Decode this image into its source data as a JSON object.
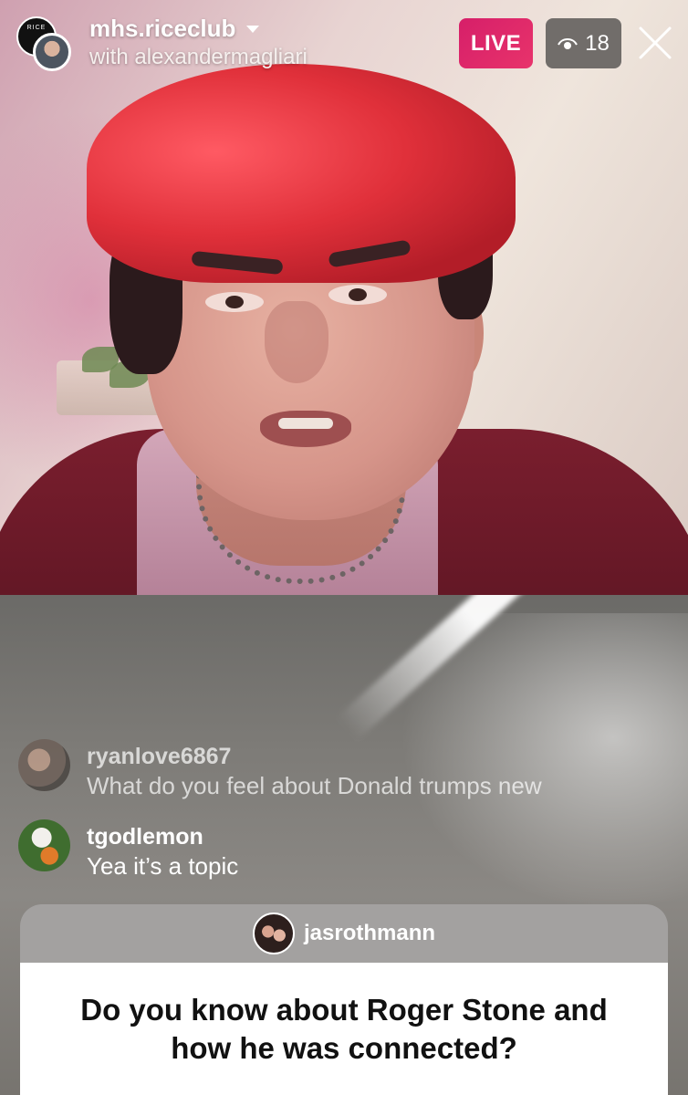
{
  "header": {
    "host_avatar_text": "RICE",
    "host_name": "mhs.riceclub",
    "with_line": "with alexandermagliari",
    "live_label": "LIVE",
    "viewer_count": "18"
  },
  "icons": {
    "viewers": "eye-icon",
    "close": "close-icon",
    "dropdown": "caret-down-icon"
  },
  "colors": {
    "live_badge": "#e0286a",
    "viewer_badge": "#5a5856",
    "question_header": "#a3a1a0"
  },
  "comments": [
    {
      "username": "ryanlove6867",
      "message": "What do you feel about Donald trumps new"
    },
    {
      "username": "tgodlemon",
      "message": "Yea it’s a topic"
    }
  ],
  "question": {
    "username": "jasrothmann",
    "text": "Do you know about Roger Stone and how he was connected?"
  }
}
